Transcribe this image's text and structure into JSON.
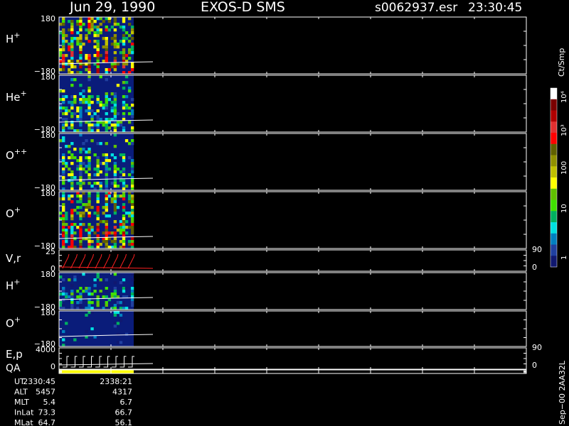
{
  "header": {
    "date": "Jun 29, 1990",
    "instrument": "EXOS-D SMS",
    "file": "s0062937.esr",
    "time": "23:30:45"
  },
  "colorbar": {
    "unit": "Ct/Smp",
    "labels": [
      "10⁴",
      "10³",
      "100",
      "10",
      "1"
    ],
    "colors": [
      "#ffffff",
      "#7a0000",
      "#b00000",
      "#e03030",
      "#ff0000",
      "#606000",
      "#909000",
      "#c0c000",
      "#ffff00",
      "#60c000",
      "#40e000",
      "#00b060",
      "#00e0e0",
      "#0080c0",
      "#2040a0",
      "#101870"
    ]
  },
  "colors": {
    "background": "#000000",
    "axis": "#ffffff",
    "panel_fill": "#0a1c7a",
    "data_start_x_frac": 0.0,
    "velocity_trace": "#ff2020",
    "qa_bar": "#ffff00"
  },
  "chart_data": {
    "type": "heatmap",
    "panels": [
      {
        "id": "h-plus-1",
        "label": "H",
        "sup": "+",
        "ytop": "180",
        "ybot": "−180",
        "intensity": "high"
      },
      {
        "id": "he-plus",
        "label": "He",
        "sup": "+",
        "ytop": "180",
        "ybot": "−180",
        "intensity": "mid"
      },
      {
        "id": "o-plusplus",
        "label": "O",
        "sup": "++",
        "ytop": "180",
        "ybot": "−180",
        "intensity": "mid"
      },
      {
        "id": "o-plus-1",
        "label": "O",
        "sup": "+",
        "ytop": "180",
        "ybot": "−180",
        "intensity": "high"
      },
      {
        "id": "vr",
        "label": "V,r",
        "sup": "",
        "ytop": "25",
        "ybot": "0",
        "right_top": "90",
        "right_bot": "0"
      },
      {
        "id": "h-plus-2",
        "label": "H",
        "sup": "+",
        "ytop": "180",
        "ybot": "−180",
        "intensity": "low"
      },
      {
        "id": "o-plus-2",
        "label": "O",
        "sup": "+",
        "ytop": "180",
        "ybot": "−180",
        "intensity": "vlow"
      },
      {
        "id": "ep",
        "label": "E,p",
        "sup": "",
        "ytop": "4000",
        "ybot": "0",
        "right_top": "90",
        "right_bot": "0"
      },
      {
        "id": "qa",
        "label": "QA",
        "sup": ""
      }
    ],
    "ephemeris": {
      "rows": [
        {
          "name": "UT",
          "v1": "2330:45",
          "v2": "2338:21"
        },
        {
          "name": "ALT",
          "v1": "5457",
          "v2": "4317"
        },
        {
          "name": "MLT",
          "v1": "5.4",
          "v2": "6.7"
        },
        {
          "name": "InLat",
          "v1": "73.3",
          "v2": "66.7"
        },
        {
          "name": "MLat",
          "v1": "64.7",
          "v2": "56.1"
        }
      ]
    },
    "footer_vertical": "Sep−00 2AA32L"
  }
}
